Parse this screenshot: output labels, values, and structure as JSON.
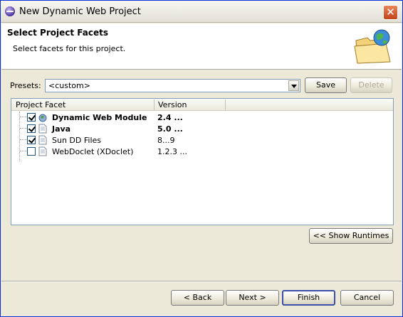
{
  "window": {
    "title": "New Dynamic Web Project",
    "close_label": "✕"
  },
  "banner": {
    "title": "Select Project Facets",
    "description": "Select facets for this project."
  },
  "presets": {
    "label": "Presets:",
    "value": "<custom>",
    "save_label": "Save",
    "delete_label": "Delete"
  },
  "table": {
    "columns": [
      "Project Facet",
      "Version"
    ],
    "rows": [
      {
        "name": "Dynamic Web Module",
        "version": "2.4 ...",
        "checked": true,
        "bold": true,
        "icon": "globe-facet-icon"
      },
      {
        "name": "Java",
        "version": "5.0 ...",
        "checked": true,
        "bold": true,
        "icon": "document-facet-icon"
      },
      {
        "name": "Sun DD Files",
        "version": "8...9",
        "checked": true,
        "bold": false,
        "icon": "document-facet-icon"
      },
      {
        "name": "WebDoclet (XDoclet)",
        "version": "1.2.3 ...",
        "checked": false,
        "bold": false,
        "icon": "document-facet-icon"
      }
    ]
  },
  "show_runtimes_label": "<< Show Runtimes",
  "footer": {
    "back_label": "< Back",
    "next_label": "Next >",
    "finish_label": "Finish",
    "cancel_label": "Cancel"
  }
}
